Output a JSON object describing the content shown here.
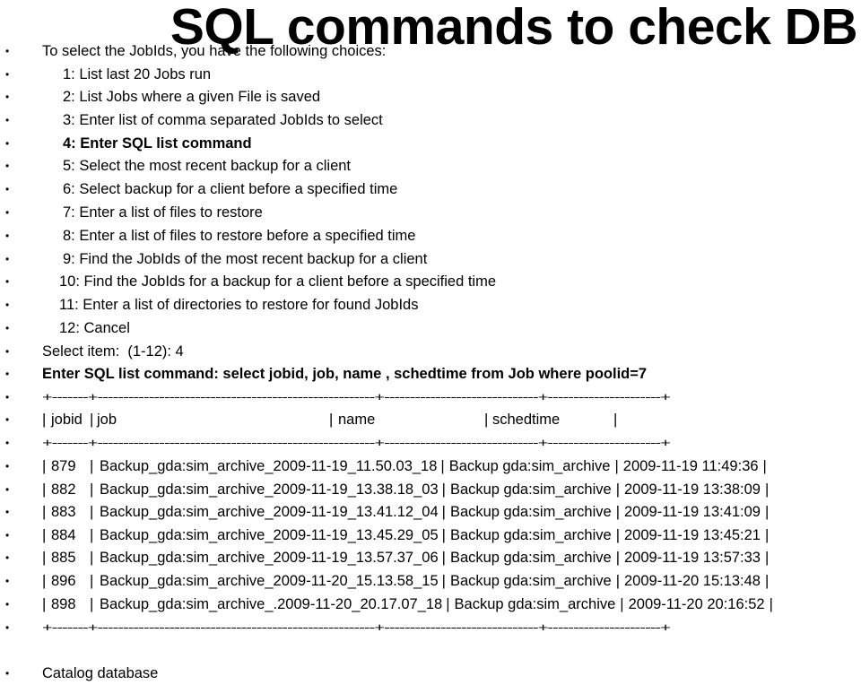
{
  "title": "SQL commands to check DB",
  "intro": "To select the JobIds, you have the following choices:",
  "choices": [
    "1: List last 20 Jobs run",
    "2: List Jobs where a given File is saved",
    "3: Enter list of comma separated JobIds to select",
    "4: Enter SQL list command",
    "5: Select the most recent backup for a client",
    "6: Select backup for a client before a specified time",
    "7: Enter a list of files to restore",
    "8: Enter a list of files to restore before a specified time",
    "9: Find the JobIds of the most recent backup for a client",
    "10: Find the JobIds for a backup for a client before a specified time",
    "11: Enter a list of directories to restore for found JobIds",
    "12: Cancel"
  ],
  "select_prompt": "Select item:  (1-12): 4",
  "sql_command": "Enter SQL list command: select jobid, job, name , schedtime from Job where poolid=7",
  "separator": "+-------+------------------------------------------------------+------------------------------+----------------------+",
  "table": {
    "headers": [
      "jobid",
      "job",
      "name",
      "schedtime"
    ],
    "rows": [
      {
        "jobid": "879",
        "job": "Backup_gda:sim_archive_2009-11-19_11.50.03_18",
        "name": "Backup gda:sim_archive",
        "schedtime": "2009-11-19 11:49:36"
      },
      {
        "jobid": "882",
        "job": "Backup_gda:sim_archive_2009-11-19_13.38.18_03",
        "name": "Backup gda:sim_archive",
        "schedtime": "2009-11-19 13:38:09"
      },
      {
        "jobid": "883",
        "job": "Backup_gda:sim_archive_2009-11-19_13.41.12_04",
        "name": "Backup gda:sim_archive",
        "schedtime": "2009-11-19 13:41:09"
      },
      {
        "jobid": "884",
        "job": "Backup_gda:sim_archive_2009-11-19_13.45.29_05",
        "name": "Backup gda:sim_archive",
        "schedtime": "2009-11-19 13:45:21"
      },
      {
        "jobid": "885",
        "job": "Backup_gda:sim_archive_2009-11-19_13.57.37_06",
        "name": "Backup gda:sim_archive",
        "schedtime": "2009-11-19 13:57:33"
      },
      {
        "jobid": "896",
        "job": "Backup_gda:sim_archive_2009-11-20_15.13.58_15",
        "name": "Backup gda:sim_archive",
        "schedtime": "2009-11-20 15:13:48"
      },
      {
        "jobid": "898",
        "job": "Backup_gda:sim_archive_.2009-11-20_20.17.07_18",
        "name": "Backup gda:sim_archive",
        "schedtime": "2009-11-20 20:16:52"
      }
    ]
  },
  "footer_item": "Catalog database",
  "bullet_glyph": "•"
}
